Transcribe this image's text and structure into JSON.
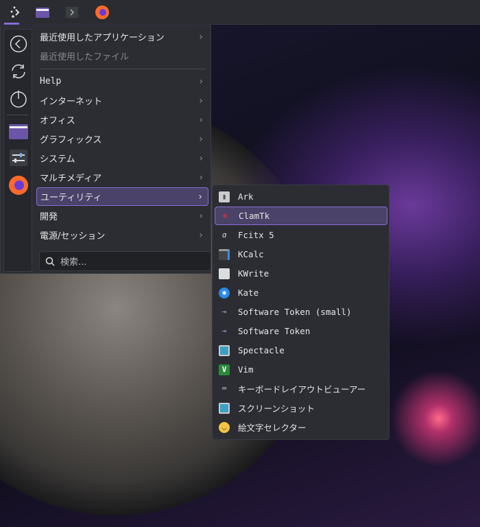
{
  "taskbar": {
    "items": [
      {
        "name": "app-launcher"
      },
      {
        "name": "file-manager"
      },
      {
        "name": "terminal"
      },
      {
        "name": "firefox"
      }
    ]
  },
  "menu": {
    "items": [
      {
        "label": "最近使用したアプリケーション",
        "chevron": true
      },
      {
        "label": "最近使用したファイル",
        "chevron": false,
        "disabled": true
      },
      {
        "label": "Help",
        "chevron": true
      },
      {
        "label": "インターネット",
        "chevron": true
      },
      {
        "label": "オフィス",
        "chevron": true
      },
      {
        "label": "グラフィックス",
        "chevron": true
      },
      {
        "label": "システム",
        "chevron": true
      },
      {
        "label": "マルチメディア",
        "chevron": true
      },
      {
        "label": "ユーティリティ",
        "chevron": true,
        "highlighted": true
      },
      {
        "label": "開発",
        "chevron": true
      },
      {
        "label": "電源/セッション",
        "chevron": true
      }
    ],
    "search_placeholder": "検索..."
  },
  "submenu": {
    "items": [
      {
        "label": "Ark",
        "icon": "archive-icon"
      },
      {
        "label": "ClamTk",
        "icon": "clamtk-icon",
        "highlighted": true
      },
      {
        "label": "Fcitx 5",
        "icon": "fcitx-icon"
      },
      {
        "label": "KCalc",
        "icon": "calculator-icon"
      },
      {
        "label": "KWrite",
        "icon": "text-editor-icon"
      },
      {
        "label": "Kate",
        "icon": "kate-icon"
      },
      {
        "label": "Software Token (small)",
        "icon": "key-icon"
      },
      {
        "label": "Software Token",
        "icon": "key-icon"
      },
      {
        "label": "Spectacle",
        "icon": "screenshot-icon"
      },
      {
        "label": "Vim",
        "icon": "vim-icon"
      },
      {
        "label": "キーボードレイアウトビューアー",
        "icon": "keyboard-icon"
      },
      {
        "label": "スクリーンショット",
        "icon": "screenshot-icon"
      },
      {
        "label": "絵文字セレクター",
        "icon": "emoji-icon"
      }
    ]
  },
  "colors": {
    "accent": "#8a6fd6",
    "highlight": "#4a4268",
    "panel": "#2b2d33"
  }
}
